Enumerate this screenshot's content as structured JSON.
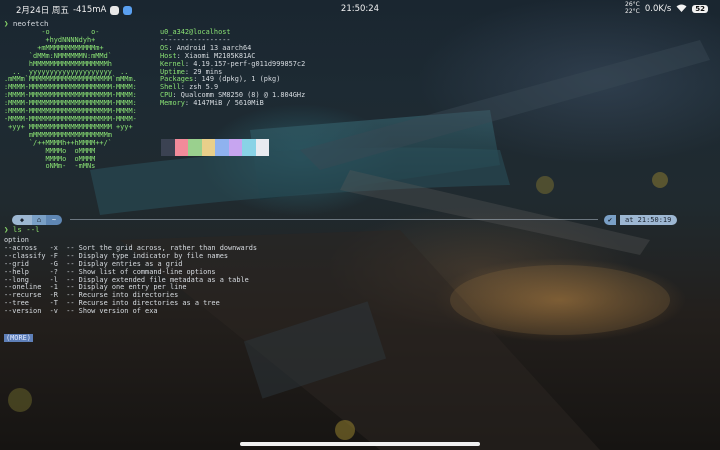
{
  "status_bar": {
    "date": "2月24日 周五",
    "current": "-415mA",
    "time": "21:50:24",
    "temp_top": "26°C",
    "temp_bottom": "22°C",
    "net_speed": "0.0K/s",
    "battery": "52"
  },
  "terminal": {
    "prompt_symbol": "❯",
    "first_command": "neofetch",
    "logo_lines": [
      "         -o          o-",
      "          +hydNNNNdyh+",
      "        +mMMMMMMMMMMMMm+",
      "      `dMMm:NMMMMMMN:mMMd`",
      "      hMMMMMMMMMMMMMMMMMMh",
      "  ..  yyyyyyyyyyyyyyyyyyyy  ..",
      ".mMMm`MMMMMMMMMMMMMMMMMMMM`mMMm.",
      ":MMMM-MMMMMMMMMMMMMMMMMMMM-MMMM:",
      ":MMMM-MMMMMMMMMMMMMMMMMMMM-MMMM:",
      ":MMMM-MMMMMMMMMMMMMMMMMMMM-MMMM:",
      ":MMMM-MMMMMMMMMMMMMMMMMMMM-MMMM:",
      "-MMMM-MMMMMMMMMMMMMMMMMMMM-MMMM-",
      " +yy+ MMMMMMMMMMMMMMMMMMMM +yy+",
      "      mMMMMMMMMMMMMMMMMMMm",
      "      `/++MMMMh++hMMMM++/`",
      "          MMMMo  oMMMM",
      "          MMMMo  oMMMM",
      "          oNMm-  -mMNs"
    ],
    "user_host": "u0_a342@localhost",
    "separator": "-----------------",
    "info": [
      {
        "key": "OS",
        "value": "Android 13 aarch64"
      },
      {
        "key": "Host",
        "value": "Xiaomi M2105K81AC"
      },
      {
        "key": "Kernel",
        "value": "4.19.157-perf-g011d999857c2"
      },
      {
        "key": "Uptime",
        "value": "29 mins"
      },
      {
        "key": "Packages",
        "value": "149 (dpkg), 1 (pkg)"
      },
      {
        "key": "Shell",
        "value": "zsh 5.9"
      },
      {
        "key": "CPU",
        "value": "Qualcomm SM8250 (8) @ 1.804GHz"
      },
      {
        "key": "Memory",
        "value": "4147MiB / 5610MiB"
      }
    ],
    "palette": [
      "#3b4252",
      "#f28b9a",
      "#9ad08e",
      "#e9cf8a",
      "#8fb2ef",
      "#c7a5f0",
      "#89d3e6",
      "#e8ebf0"
    ],
    "prompt_bar": {
      "seg1_icon": "◆",
      "seg2_icon": "⌂",
      "seg3_icon": "~"
    },
    "right_prompt": {
      "check": "✔",
      "time": "at 21:50:19"
    },
    "second_command": "ls --l",
    "help_header": "option",
    "help_lines": [
      "--across   -x  -- Sort the grid across, rather than downwards",
      "--classify -F  -- Display type indicator by file names",
      "--grid     -G  -- Display entries as a grid",
      "--help     -?  -- Show list of command-line options",
      "--long     -l  -- Display extended file metadata as a table",
      "--oneline  -1  -- Display one entry per line",
      "--recurse  -R  -- Recurse into directories",
      "--tree     -T  -- Recurse into directories as a tree",
      "--version  -v  -- Show version of exa"
    ],
    "more_label": "(MORE)"
  },
  "icons": {
    "sb_app1": "rose-app-icon",
    "sb_app2": "blue-app-icon",
    "wifi": "wifi-icon"
  }
}
